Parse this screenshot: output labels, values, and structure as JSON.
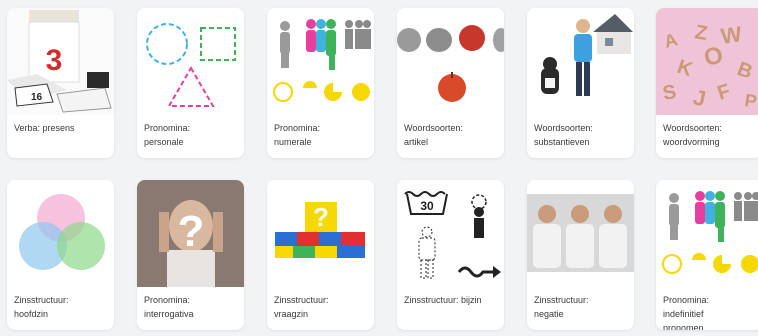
{
  "cards": [
    {
      "line1": "Verba: presens",
      "line2": "",
      "line3": "",
      "icon": "calendar-image"
    },
    {
      "line1": "Pronomina:",
      "line2": "personale",
      "line3": "",
      "icon": "shapes-image"
    },
    {
      "line1": "Pronomina:",
      "line2": "numerale",
      "line3": "",
      "icon": "people-numbers-image"
    },
    {
      "line1": "Woordsoorten:",
      "line2": "artikel",
      "line3": "",
      "icon": "apples-image"
    },
    {
      "line1": "Woordsoorten:",
      "line2": "substantieven",
      "line3": "",
      "icon": "boy-house-cat-image"
    },
    {
      "line1": "Woordsoorten:",
      "line2": "woordvorming",
      "line3": "",
      "icon": "letters-image"
    },
    {
      "line1": "Zinsstructuur:",
      "line2": "hoofdzin",
      "line3": "",
      "icon": "venn-circles-image"
    },
    {
      "line1": "Pronomina:",
      "line2": "interrogativa",
      "line3": "",
      "icon": "question-person-image"
    },
    {
      "line1": "Zinsstructuur:",
      "line2": "vraagzin",
      "line3": "",
      "icon": "lego-question-image"
    },
    {
      "line1": "Zinsstructuur: bijzin",
      "line2": "",
      "line3": "",
      "icon": "laundry-symbols-image"
    },
    {
      "line1": "Zinsstructuur:",
      "line2": "negatie",
      "line3": "",
      "icon": "three-men-image"
    },
    {
      "line1": "Pronomina:",
      "line2": "indefinitief",
      "line3": "pronomen",
      "icon": "people-numbers-image"
    }
  ],
  "calendar_number": "3",
  "laundry_temp": "30",
  "letters": [
    "A",
    "Z",
    "W",
    "K",
    "O",
    "B",
    "S",
    "J",
    "F",
    "P"
  ]
}
